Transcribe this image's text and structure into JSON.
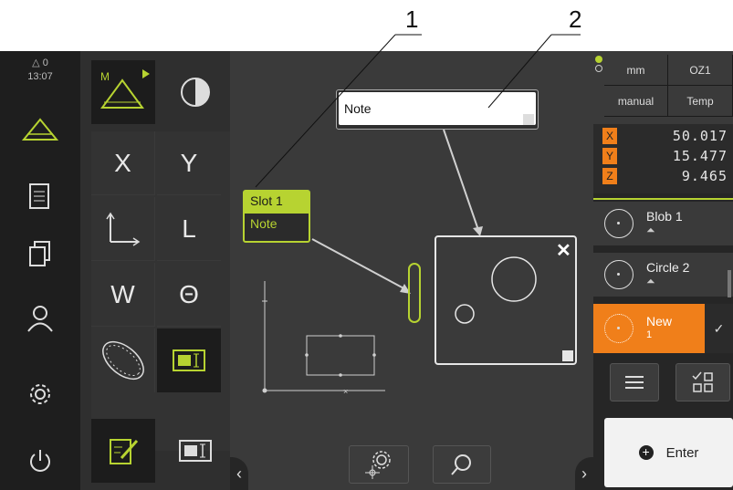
{
  "callouts": [
    "1",
    "2"
  ],
  "status": {
    "alert_count": "0",
    "time": "13:07"
  },
  "tools": {
    "x": "X",
    "y": "Y",
    "l": "L",
    "w": "W",
    "theta": "Θ"
  },
  "workspace": {
    "slot_label": "Slot 1",
    "slot_note": "Note",
    "note_field": "Note"
  },
  "right": {
    "units": "mm",
    "ref": "OZ1",
    "mode": "manual",
    "temp": "Temp",
    "coords": [
      {
        "axis": "X",
        "value": "50.017"
      },
      {
        "axis": "Y",
        "value": "15.477"
      },
      {
        "axis": "Z",
        "value": "9.465"
      }
    ],
    "features": [
      {
        "name": "Blob 1"
      },
      {
        "name": "Circle 2"
      }
    ],
    "new_feature": {
      "name": "New",
      "index": "1"
    },
    "enter_label": "Enter"
  },
  "colors": {
    "accent_green": "#b7d331",
    "accent_orange": "#f07f1a",
    "dark": "#2b2b2b"
  },
  "icons": [
    "triangle-alert-icon",
    "measure-icon",
    "document-icon",
    "copy-icon",
    "user-icon",
    "gear-icon",
    "power-icon",
    "contrast-icon",
    "axis-icon",
    "ellipse-fit-icon",
    "measure-frame-icon",
    "edit-icon",
    "settings-target-icon",
    "search-icon",
    "menu-icon",
    "grid-check-icon",
    "add-icon"
  ]
}
